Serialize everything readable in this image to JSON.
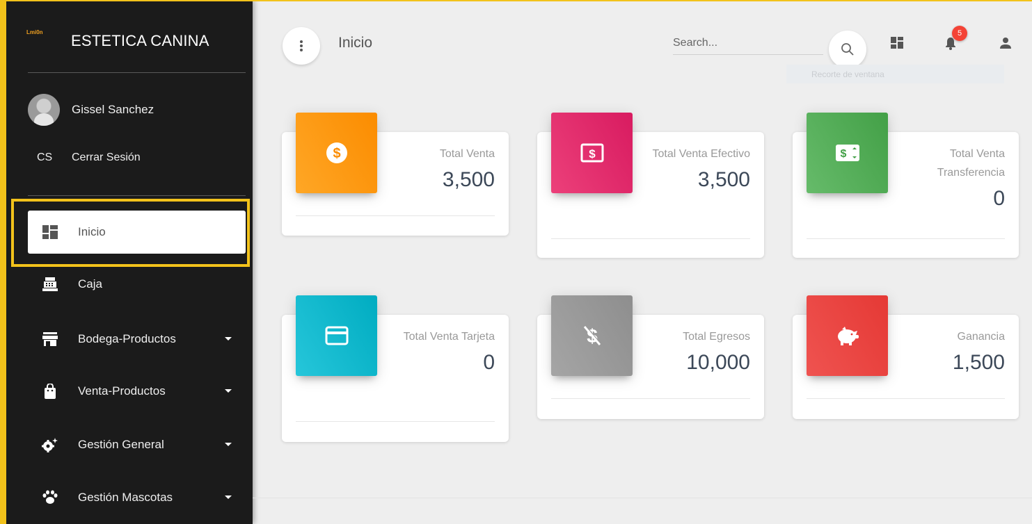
{
  "sidebar": {
    "logo_mini": "Lmi0n",
    "brand": "ESTETICA CANINA",
    "user_name": "Gissel Sanchez",
    "logout_abbr": "CS",
    "logout_label": "Cerrar Sesión",
    "items": [
      {
        "label": "Inicio",
        "icon": "dashboard-icon",
        "active": true
      },
      {
        "label": "Caja",
        "icon": "cash-register-icon"
      },
      {
        "label": "Bodega-Productos",
        "icon": "store-icon",
        "dropdown": true
      },
      {
        "label": "Venta-Productos",
        "icon": "shopping-bag-icon",
        "dropdown": true
      },
      {
        "label": "Gestión General",
        "icon": "gears-icon",
        "dropdown": true
      },
      {
        "label": "Gestión Mascotas",
        "icon": "paw-icon",
        "dropdown": true
      }
    ],
    "accent": "#f2c21b"
  },
  "header": {
    "title": "Inicio",
    "search_placeholder": "Search...",
    "notification_count": "5",
    "tooltip": "Recorte de ventana"
  },
  "cards": [
    {
      "category": "Total Venta",
      "value": "3,500",
      "color": "#ff9800",
      "icon": "dollar-circle-icon"
    },
    {
      "category": "Total Venta Efectivo",
      "value": "3,500",
      "color": "#e91e63",
      "icon": "cash-icon"
    },
    {
      "category": "Total Venta Transferencia",
      "value": "0",
      "color": "#4caf50",
      "icon": "money-transfer-icon"
    },
    {
      "category": "Total Venta Tarjeta",
      "value": "0",
      "color": "#00bcd4",
      "icon": "credit-card-icon"
    },
    {
      "category": "Total Egresos",
      "value": "10,000",
      "color": "#999999",
      "icon": "money-off-icon"
    },
    {
      "category": "Ganancia",
      "value": "1,500",
      "color": "#f44336",
      "icon": "piggy-bank-icon"
    }
  ]
}
